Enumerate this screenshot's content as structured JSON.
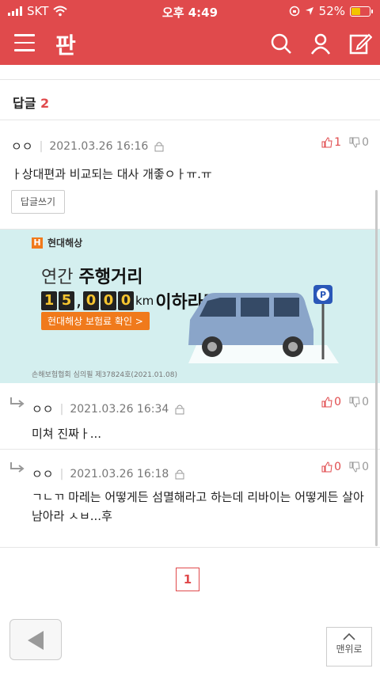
{
  "status": {
    "carrier": "SKT",
    "time": "오후 4:49",
    "battery": "52%",
    "battery_color": "#f2c400"
  },
  "header": {
    "logo": "판",
    "brand_color": "#e04a4c"
  },
  "section": {
    "title": "답글",
    "count": "2"
  },
  "comments": [
    {
      "nick": "ㅇㅇ",
      "date": "2021.03.26 16:16",
      "up": "1",
      "down": "0",
      "text": "ㅏ상대편과 비교되는 대사 개좋ㅇㅏㅠ.ㅠ",
      "reply_label": "답글쓰기"
    },
    {
      "nick": "ㅇㅇ",
      "date": "2021.03.26 16:34",
      "up": "0",
      "down": "0",
      "text": "미쳐 진짜ㅏ..."
    },
    {
      "nick": "ㅇㅇ",
      "date": "2021.03.26 16:18",
      "up": "0",
      "down": "0",
      "text": "ㄱㄴㄲ 마레는 어떻게든 섬멸해라고 하는데 리바이는 어떻게든 살아남아라 ㅅㅂ...후"
    }
  ],
  "ad": {
    "brand": "현대해상",
    "line1_a": "연간 ",
    "line1_b": "주행거리",
    "digits": [
      "1",
      "5",
      "0",
      "0",
      "0"
    ],
    "comma": ",",
    "line2_tail": "이하라면?",
    "unit": "km",
    "cta": "현대해상 보험료 확인 >",
    "footnote": "손해보험협회 심의필 제37824호(2021.01.08)"
  },
  "pagination": {
    "current": "1"
  },
  "footer": {
    "top_label": "맨위로"
  }
}
